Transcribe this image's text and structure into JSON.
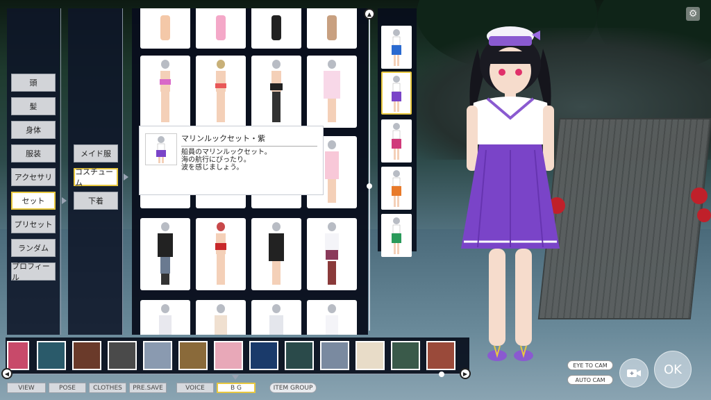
{
  "categories": [
    {
      "label": "頭",
      "active": false
    },
    {
      "label": "髪",
      "active": false
    },
    {
      "label": "身体",
      "active": false
    },
    {
      "label": "服装",
      "active": false
    },
    {
      "label": "アクセサリ",
      "active": false
    },
    {
      "label": "セット",
      "active": true
    },
    {
      "label": "プリセット",
      "active": false
    },
    {
      "label": "ランダム",
      "active": false
    },
    {
      "label": "プロフィール",
      "active": false
    }
  ],
  "subcategories": [
    {
      "label": "メイド服",
      "active": false
    },
    {
      "label": "コスチューム",
      "active": true
    },
    {
      "label": "下着",
      "active": false
    }
  ],
  "tooltip": {
    "title": "マリンルックセット・紫",
    "lines": [
      "船員のマリンルックセット。",
      "海の航行にぴったり。",
      "波を感じましょう。"
    ]
  },
  "toolbar": {
    "tabs": [
      {
        "label": "VIEW",
        "active": false
      },
      {
        "label": "POSE",
        "active": false
      },
      {
        "label": "CLOTHES",
        "active": false
      },
      {
        "label": "PRE.SAVE",
        "active": false
      },
      {
        "label": "VOICE",
        "active": false
      },
      {
        "label": "B G",
        "active": true
      },
      {
        "label": "ITEM GROUP",
        "active": false
      }
    ]
  },
  "camera": {
    "eye_to_cam": "EYE TO CAM",
    "auto_cam": "AUTO CAM"
  },
  "ok_label": "OK",
  "icons": {
    "scroll_up": "triangle-up-icon",
    "scroll_left": "triangle-left-icon",
    "scroll_right": "triangle-right-icon",
    "settings": "gear-icon",
    "camera_add": "camera-plus-icon"
  },
  "colors": {
    "accent_border": "#e8c840",
    "panel": "#0e1628",
    "button": "#d2d4d8"
  }
}
